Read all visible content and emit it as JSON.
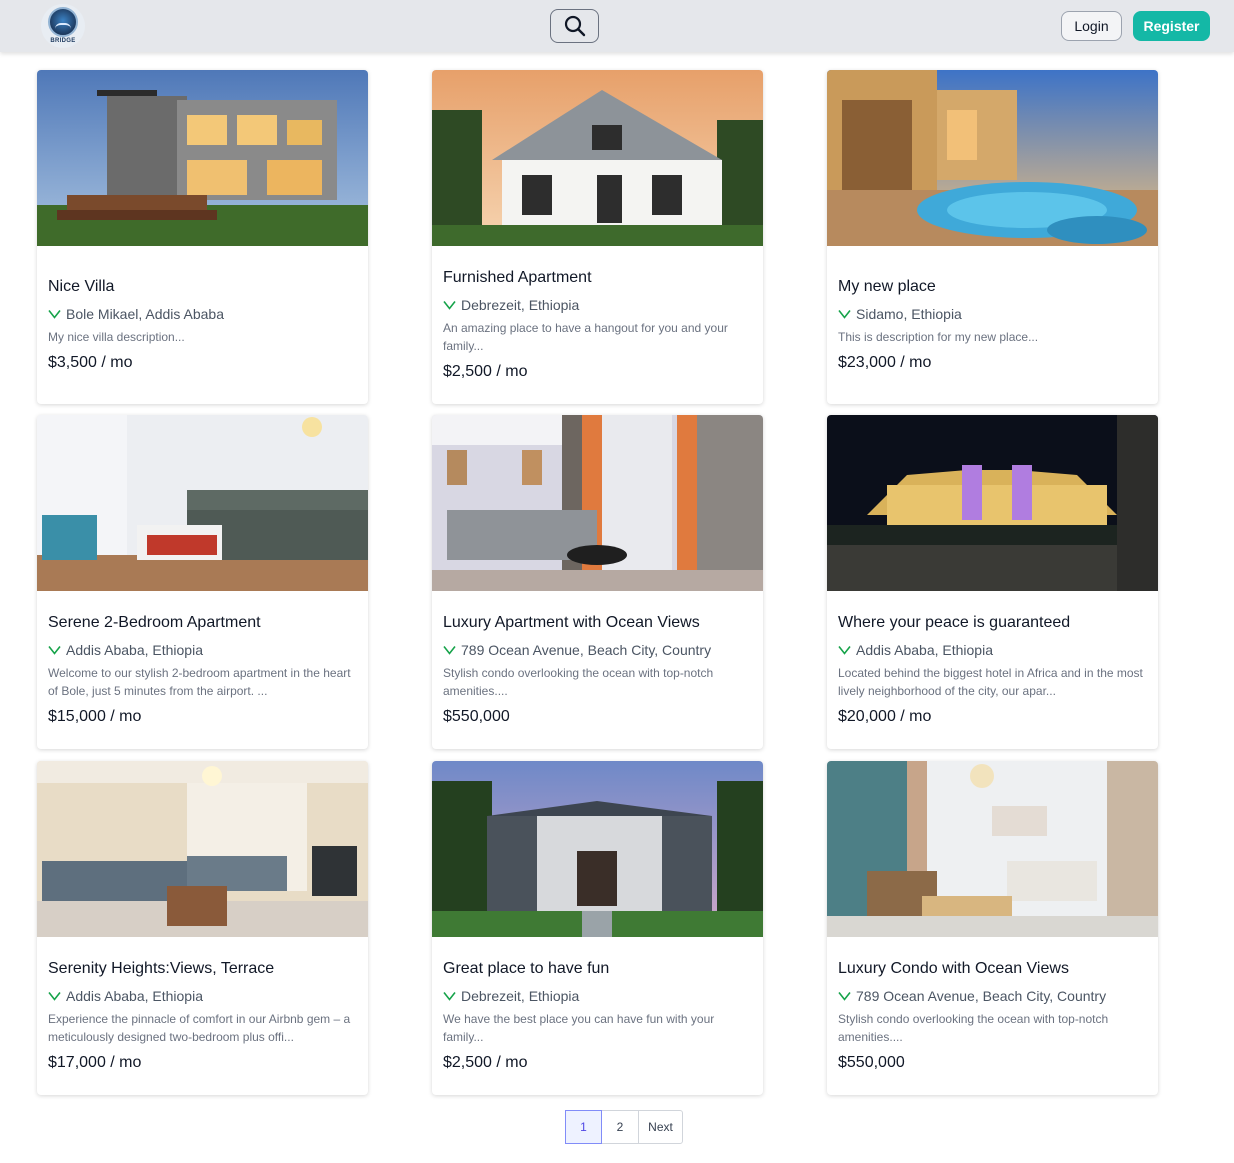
{
  "brand": {
    "name": "BRIDGE"
  },
  "header": {
    "login_label": "Login",
    "register_label": "Register"
  },
  "colors": {
    "accent": "#14b8a6",
    "location_icon": "#16a34a",
    "pagination_active": "#4f46e5"
  },
  "listings": [
    {
      "title": "Nice Villa",
      "location": "Bole Mikael, Addis Ababa",
      "description": "My nice villa description...",
      "price": "$3,500 / mo"
    },
    {
      "title": "Furnished Apartment",
      "location": "Debrezeit, Ethiopia",
      "description": "An amazing place to have a hangout for you and your family...",
      "price": "$2,500 / mo"
    },
    {
      "title": "My new place",
      "location": "Sidamo, Ethiopia",
      "description": "This is description for my new place...",
      "price": "$23,000 / mo"
    },
    {
      "title": "Serene 2-Bedroom Apartment",
      "location": "Addis Ababa, Ethiopia",
      "description": "Welcome to our stylish 2-bedroom apartment in the heart of Bole, just 5 minutes from the airport. ...",
      "price": "$15,000 / mo"
    },
    {
      "title": "Luxury Apartment with Ocean Views",
      "location": "789 Ocean Avenue, Beach City, Country",
      "description": "Stylish condo overlooking the ocean with top-notch amenities....",
      "price": "$550,000"
    },
    {
      "title": "Where your peace is guaranteed",
      "location": "Addis Ababa, Ethiopia",
      "description": "Located behind the biggest hotel in Africa and in the most lively neighborhood of the city, our apar...",
      "price": "$20,000 / mo"
    },
    {
      "title": "Serenity Heights:Views, Terrace",
      "location": "Addis Ababa, Ethiopia",
      "description": "Experience the pinnacle of comfort in our Airbnb gem – a meticulously designed two-bedroom plus offi...",
      "price": "$17,000 / mo"
    },
    {
      "title": "Great place to have fun",
      "location": "Debrezeit, Ethiopia",
      "description": "We have the best place you can have fun with your family...",
      "price": "$2,500 / mo"
    },
    {
      "title": "Luxury Condo with Ocean Views",
      "location": "789 Ocean Avenue, Beach City, Country",
      "description": "Stylish condo overlooking the ocean with top-notch amenities....",
      "price": "$550,000"
    }
  ],
  "pagination": {
    "pages": [
      "1",
      "2"
    ],
    "current": "1",
    "next_label": "Next"
  }
}
